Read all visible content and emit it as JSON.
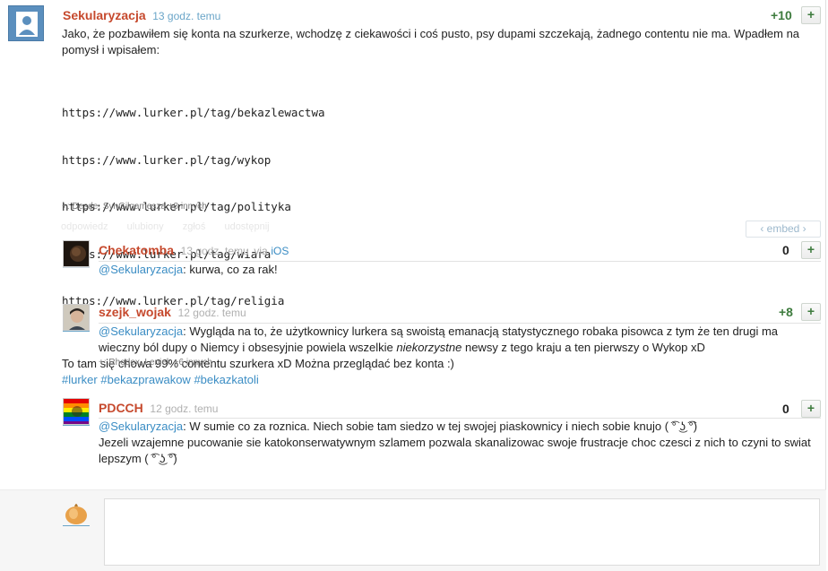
{
  "post": {
    "author": "Sekularyzacja",
    "time": "13 godz. temu",
    "votes": "+10",
    "plus_label": "+",
    "text_intro": "Jako, że pozbawiłem się konta na szurkerze, wchodzę z ciekawości i coś pusto, psy dupami szczekają, żadnego contentu nie ma. Wpadłem na pomysł i wpisałem:",
    "urls": [
      "https://www.lurker.pl/tag/bekazlewactwa",
      "https://www.lurker.pl/tag/wykop",
      "https://www.lurker.pl/tag/polityka",
      "https://www.lurker.pl/tag/wiara",
      "https://www.lurker.pl/tag/religia"
    ],
    "text_outro": "To tam się chowa 99% contentu szurkera xD Można przeglądać bez konta :)",
    "tags": [
      "#lurker",
      "#bekazprawakow",
      "#bekazkatoli"
    ],
    "voters_prefix": "+:",
    "voters": "Desde, SynGilgamesza",
    "voters_more": "+8 innych",
    "actions": [
      "odpowiedz",
      "ulubiony",
      "zgłoś",
      "udostępnij"
    ],
    "embed_label": "‹ embed ›"
  },
  "comments": [
    {
      "author": "Chekatomba",
      "time": "13 godz. temu",
      "via_prefix": "via",
      "via": "iOS",
      "votes": "0",
      "mention": "@Sekularyzacja",
      "text": ": kurwa, co za rak!"
    },
    {
      "author": "szejk_wojak",
      "time": "12 godz. temu",
      "votes": "+8",
      "mention": "@Sekularyzacja",
      "text_a": ": Wygląda na to, że użytkownicy lurkera są swoistą emanacją statystycznego robaka pisowca z tym że ten drugi ma wieczny ból dupy o Niemcy i obsesyjnie powiela wszelkie ",
      "text_em": "niekorzystne",
      "text_b": " newsy z tego kraju a ten pierwszy o Wykop xD",
      "voters_prefix": "+:",
      "voters": "Rhodox, Leniek",
      "voters_more": "+6 innych"
    },
    {
      "author": "PDCCH",
      "time": "12 godz. temu",
      "votes": "0",
      "mention": "@Sekularyzacja",
      "text_a": ": W sumie co za roznica. Niech sobie tam siedzo w tej swojej piaskownicy i niech sobie knujo ( ͡° ͜ʖ ͡°)",
      "text_b": "Jezeli wzajemne pucowanie sie katokonserwatywnym szlamem pozwala skanalizowac swoje frustracje choc czesci z nich to czyni to swiat lepszym ( ͡° ͜ʖ ͡°)"
    }
  ],
  "colors": {
    "author": "#c6492d",
    "link": "#3b8dc4",
    "vote_positive": "#3d7b3d"
  }
}
